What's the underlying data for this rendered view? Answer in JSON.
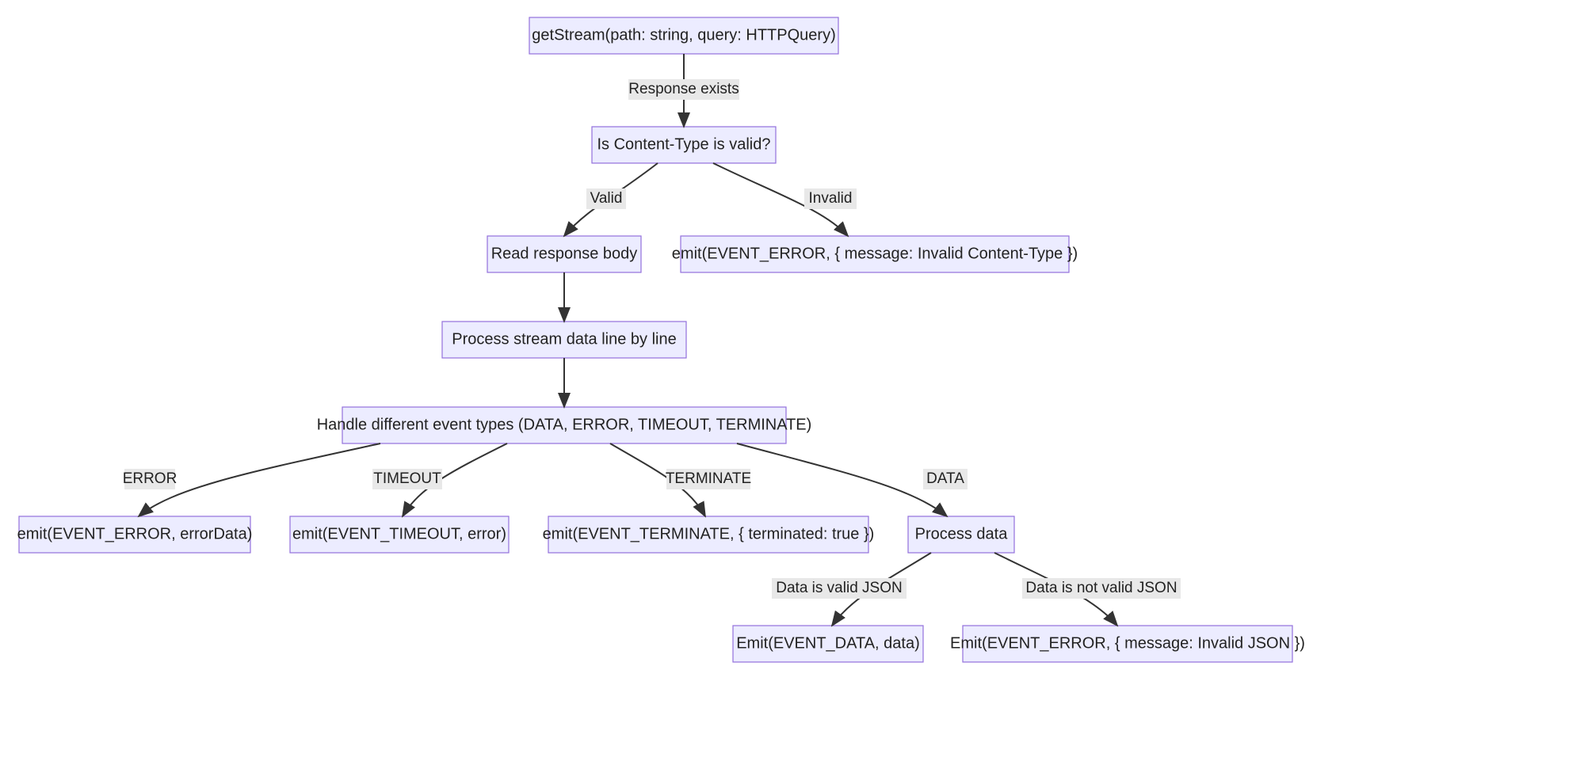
{
  "nodes": {
    "start": "getStream(path: string, query: HTTPQuery)",
    "checkCT": "Is Content-Type is valid?",
    "readBody": "Read response body",
    "invalidCT": "emit(EVENT_ERROR, { message: Invalid Content-Type })",
    "processLines": "Process stream data line by line",
    "handleEvents": "Handle different event types (DATA, ERROR, TIMEOUT, TERMINATE)",
    "emitError": "emit(EVENT_ERROR, errorData)",
    "emitTimeout": "emit(EVENT_TIMEOUT, error)",
    "emitTerminate": "emit(EVENT_TERMINATE, { terminated: true })",
    "processData": "Process data",
    "emitData": "Emit(EVENT_DATA, data)",
    "emitBadJSON": "Emit(EVENT_ERROR, { message: Invalid JSON })"
  },
  "edges": {
    "responseExists": "Response exists",
    "valid": "Valid",
    "invalid": "Invalid",
    "error": "ERROR",
    "timeout": "TIMEOUT",
    "terminate": "TERMINATE",
    "data": "DATA",
    "dataValidJSON": "Data is valid JSON",
    "dataNotValidJSON": "Data is not valid JSON"
  },
  "colors": {
    "nodeFill": "#ECECFF",
    "nodeStroke": "#9370DB",
    "edge": "#333333",
    "labelBg": "#e8e8e8"
  }
}
